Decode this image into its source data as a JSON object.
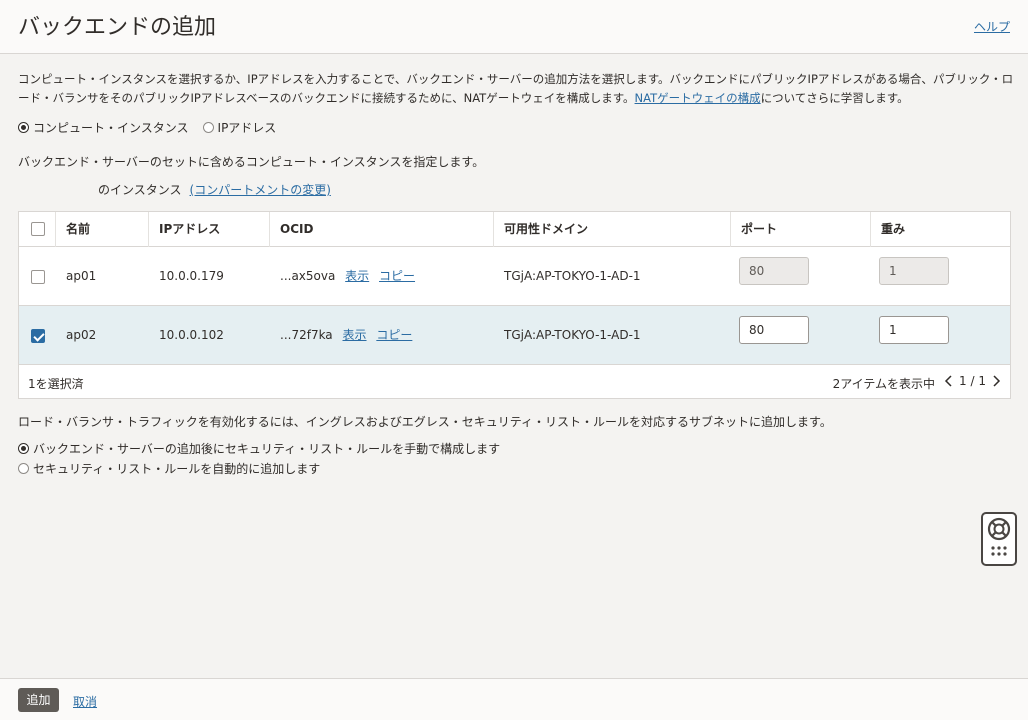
{
  "header": {
    "title": "バックエンドの追加",
    "help": "ヘルプ"
  },
  "description": {
    "text_before_link": "コンピュート・インスタンスを選択するか、IPアドレスを入力することで、バックエンド・サーバーの追加方法を選択します。バックエンドにパブリックIPアドレスがある場合、パブリック・ロード・バランサをそのパブリックIPアドレスベースのバックエンドに接続するために、NATゲートウェイを構成します。",
    "link": "NATゲートウェイの構成",
    "text_after_link": "についてさらに学習します。"
  },
  "method": {
    "options": [
      "コンピュート・インスタンス",
      "IPアドレス"
    ],
    "selected": "コンピュート・インスタンス"
  },
  "instructions": "バックエンド・サーバーのセットに含めるコンピュート・インスタンスを指定します。",
  "compartment": {
    "label": "のインスタンス",
    "change_link": "(コンパートメントの変更)"
  },
  "table": {
    "columns": [
      "名前",
      "IPアドレス",
      "OCID",
      "可用性ドメイン",
      "ポート",
      "重み"
    ],
    "rows": [
      {
        "name": "ap01",
        "ip": "10.0.0.179",
        "ocid": "...ax5ova",
        "show": "表示",
        "copy": "コピー",
        "domain": "TGjA:AP-TOKYO-1-AD-1",
        "port": "80",
        "weight": "1",
        "selected": false
      },
      {
        "name": "ap02",
        "ip": "10.0.0.102",
        "ocid": "...72f7ka",
        "show": "表示",
        "copy": "コピー",
        "domain": "TGjA:AP-TOKYO-1-AD-1",
        "port": "80",
        "weight": "1",
        "selected": true
      }
    ],
    "footer": {
      "selected_count": "1を選択済",
      "items_shown": "2アイテムを表示中",
      "page": "1 / 1"
    }
  },
  "traffic": {
    "text": "ロード・バランサ・トラフィックを有効化するには、イングレスおよびエグレス・セキュリティ・リスト・ルールを対応するサブネットに追加します。",
    "options": [
      "バックエンド・サーバーの追加後にセキュリティ・リスト・ルールを手動で構成します",
      "セキュリティ・リスト・ルールを自動的に追加します"
    ],
    "selected": "バックエンド・サーバーの追加後にセキュリティ・リスト・ルールを手動で構成します"
  },
  "footer": {
    "add": "追加",
    "cancel": "取消"
  },
  "colors": {
    "link": "#2b6ca3",
    "selected_row": "#e5eff2",
    "primary_button": "#5f5b57"
  }
}
